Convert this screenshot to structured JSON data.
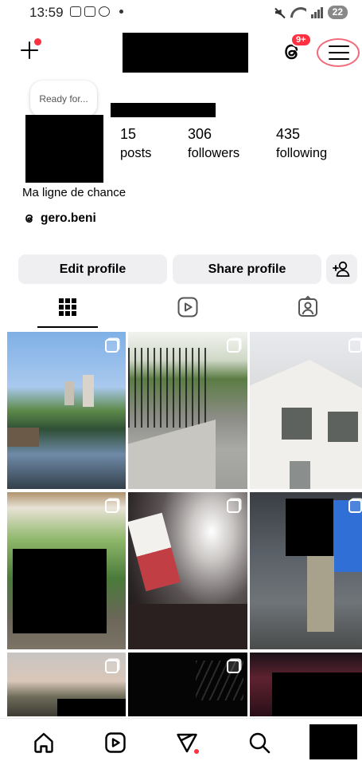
{
  "status_bar": {
    "time": "13:59",
    "battery": "22"
  },
  "header": {
    "notification_badge": "9+",
    "accent_red": "#ff3040"
  },
  "profile": {
    "note": "Ready for...",
    "stats": [
      {
        "value": "15",
        "label": "posts"
      },
      {
        "value": "306",
        "label": "followers"
      },
      {
        "value": "435",
        "label": "following"
      }
    ],
    "bio": "Ma ligne de chance",
    "threads_handle": "gero.beni"
  },
  "buttons": {
    "edit_profile": "Edit profile",
    "share_profile": "Share profile"
  },
  "tabs": [
    "grid-icon",
    "reels-icon",
    "tagged-icon"
  ],
  "grid": {
    "tile_icons": [
      "multi-photo-icon"
    ]
  },
  "bottom_nav": [
    "home-icon",
    "reels-icon",
    "direct-icon",
    "search-icon",
    "profile-avatar"
  ]
}
